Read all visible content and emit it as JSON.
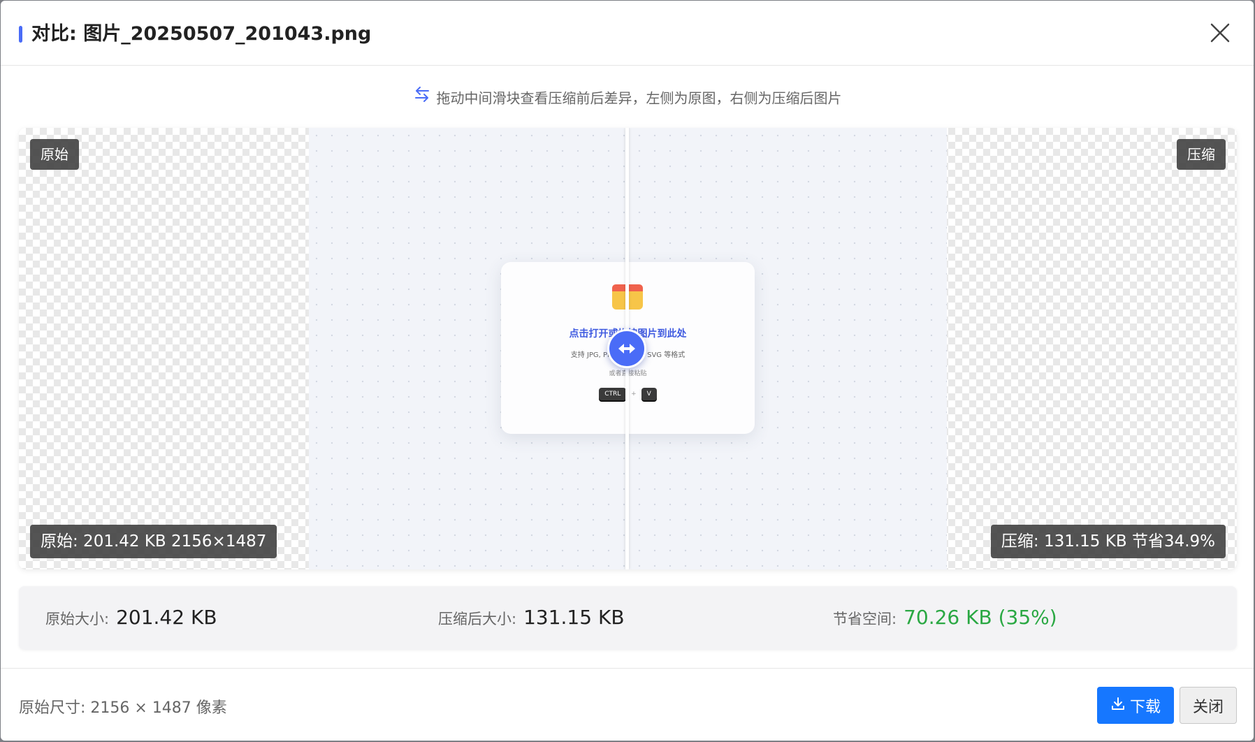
{
  "dialog": {
    "title": "对比: 图片_20250507_201043.png",
    "hint": "拖动中间滑块查看压缩前后差异，左侧为原图，右侧为压缩后图片"
  },
  "compare": {
    "left_tag": "原始",
    "right_tag": "压缩",
    "left_info": "原始: 201.42 KB 2156×1487",
    "right_info": "压缩: 131.15 KB 节省34.9%",
    "preview": {
      "title": "点击打开或拖拽图片到此处",
      "subtitle": "支持 JPG, PNG, WEBP, SVG 等格式",
      "or_text": "或者直接粘贴",
      "key1": "CTRL",
      "plus": "+",
      "key2": "V"
    }
  },
  "stats": {
    "original_label": "原始大小:",
    "original_value": "201.42 KB",
    "compressed_label": "压缩后大小:",
    "compressed_value": "131.15 KB",
    "saved_label": "节省空间:",
    "saved_value": "70.26 KB (35%)"
  },
  "footer": {
    "dimensions": "原始尺寸: 2156 × 1487 像素",
    "download_label": "下载",
    "close_label": "关闭"
  },
  "colors": {
    "accent": "#4a6cf7",
    "primary_button": "#1677ff",
    "saved_green": "#2aa843"
  },
  "icons": [
    "swap-arrows-icon",
    "close-icon",
    "folder-icon",
    "drag-handle-icon",
    "download-icon"
  ]
}
